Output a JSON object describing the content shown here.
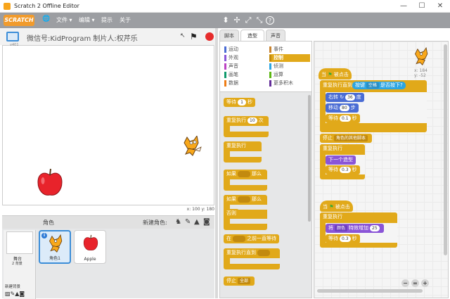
{
  "window": {
    "title": "Scratch 2 Offline Editor",
    "minimize": "—",
    "maximize": "☐",
    "close": "✕"
  },
  "menu": {
    "logo": "SCRATCH",
    "globe": "🌐",
    "file": "文件 ▾",
    "edit": "编辑 ▾",
    "tips": "提示",
    "about": "关于"
  },
  "tools": {
    "duplicate": "⬍",
    "delete": "✢",
    "grow": "⤢",
    "shrink": "⤡",
    "help": "?"
  },
  "stage": {
    "name": "微信号:KidProgram  制片人:权芹乐",
    "version": "v401",
    "coords": "x: 100   y: 180"
  },
  "sprites": {
    "heading": "角色",
    "new_sprite": "新建角色:",
    "stage_label": "舞台",
    "stage_backdrops": "2 背景",
    "new_backdrop": "新建背景",
    "items": [
      {
        "name": "角色1",
        "selected": true
      },
      {
        "name": "Apple",
        "selected": false
      }
    ]
  },
  "tabs": [
    {
      "label": "脚本",
      "active": false
    },
    {
      "label": "造型",
      "active": true
    },
    {
      "label": "声音",
      "active": false
    }
  ],
  "categories": [
    {
      "label": "运动",
      "color": "#4a6cd4",
      "active": false
    },
    {
      "label": "事件",
      "color": "#c88330",
      "active": false
    },
    {
      "label": "外观",
      "color": "#8a55d7",
      "active": false
    },
    {
      "label": "控制",
      "color": "#e1a91a",
      "active": true
    },
    {
      "label": "声音",
      "color": "#bb42c3",
      "active": false
    },
    {
      "label": "侦测",
      "color": "#2ca5e2",
      "active": false
    },
    {
      "label": "画笔",
      "color": "#0e9a6c",
      "active": false
    },
    {
      "label": "运算",
      "color": "#5cb712",
      "active": false
    },
    {
      "label": "数据",
      "color": "#ee7d16",
      "active": false
    },
    {
      "label": "更多积木",
      "color": "#632d99",
      "active": false
    }
  ],
  "palette": {
    "wait": "等待",
    "wait_val": "1",
    "sec": "秒",
    "repeat": "重复执行",
    "repeat_val": "10",
    "times": "次",
    "forever": "重复执行",
    "if_then": "如果",
    "then": "那么",
    "if_else": "如果",
    "else": "否则",
    "wait_until": "在",
    "wait_until_tail": "之前一直等待",
    "repeat_until": "重复执行直到",
    "stop": "停止",
    "stop_val": "全部"
  },
  "scripts": {
    "sprite_x": "x: 184",
    "sprite_y": "y: -52",
    "s1": {
      "hat": "当",
      "hat_tail": "被点击",
      "repeat_until": "重复执行直到",
      "key": "按键",
      "key_val": "空格",
      "key_tail": "是否按下?",
      "turn": "右转",
      "turn_val": "36",
      "deg": "度",
      "move": "移动",
      "move_val": "80",
      "steps": "步",
      "wait": "等待",
      "wait_val": "0.1",
      "sec": "秒",
      "stop": "停止",
      "stop_val": "角色的其他脚本",
      "forever": "重复执行",
      "next": "下一个造型",
      "wait2": "等待",
      "wait2_val": "0.3",
      "sec2": "秒"
    },
    "s2": {
      "hat": "当",
      "hat_tail": "被点击",
      "forever": "重复执行",
      "change": "将",
      "change_val": "颜色",
      "change_mid": "特效增加",
      "change_num": "25",
      "wait": "等待",
      "wait_val": "0.3",
      "sec": "秒"
    },
    "zoom_out": "−",
    "zoom_reset": "=",
    "zoom_in": "+"
  }
}
